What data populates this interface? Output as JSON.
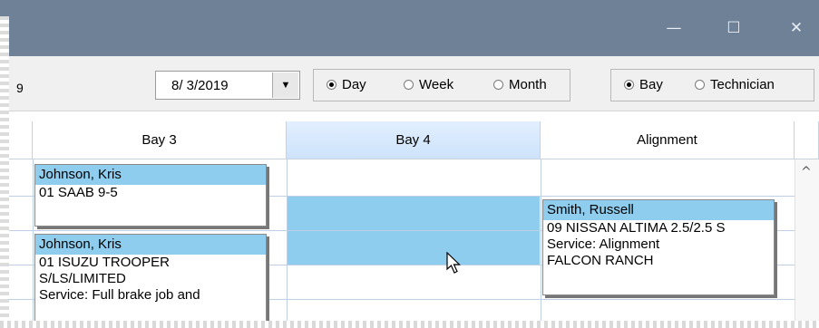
{
  "window": {
    "controls": {
      "minimize": "—",
      "maximize": "☐",
      "close": "✕"
    }
  },
  "toolbar": {
    "clipped_digit": "9",
    "date_value": "8/ 3/2019",
    "view_options": [
      {
        "label": "Day",
        "selected": true
      },
      {
        "label": "Week",
        "selected": false
      },
      {
        "label": "Month",
        "selected": false
      }
    ],
    "group_options": [
      {
        "label": "Bay",
        "selected": true
      },
      {
        "label": "Technician",
        "selected": false
      }
    ]
  },
  "columns": [
    {
      "label": "Bay 3",
      "selected": false
    },
    {
      "label": "Bay 4",
      "selected": true
    },
    {
      "label": "Alignment",
      "selected": false
    }
  ],
  "appointments": [
    {
      "name": "Johnson, Kris",
      "lines": [
        "01 SAAB 9-5"
      ]
    },
    {
      "name": "Johnson, Kris",
      "lines": [
        "01 ISUZU TROOPER",
        "S/LS/LIMITED",
        "Service: Full brake job and"
      ]
    },
    {
      "name": "Smith, Russell",
      "lines": [
        "09 NISSAN ALTIMA 2.5/2.5 S",
        "Service: Alignment",
        "FALCON RANCH"
      ]
    }
  ],
  "colors": {
    "titlebar": "#6f8197",
    "appointment_header": "#8ecdee",
    "selected_slot": "#8ecdee",
    "selected_column_header": "#cde3fb"
  }
}
